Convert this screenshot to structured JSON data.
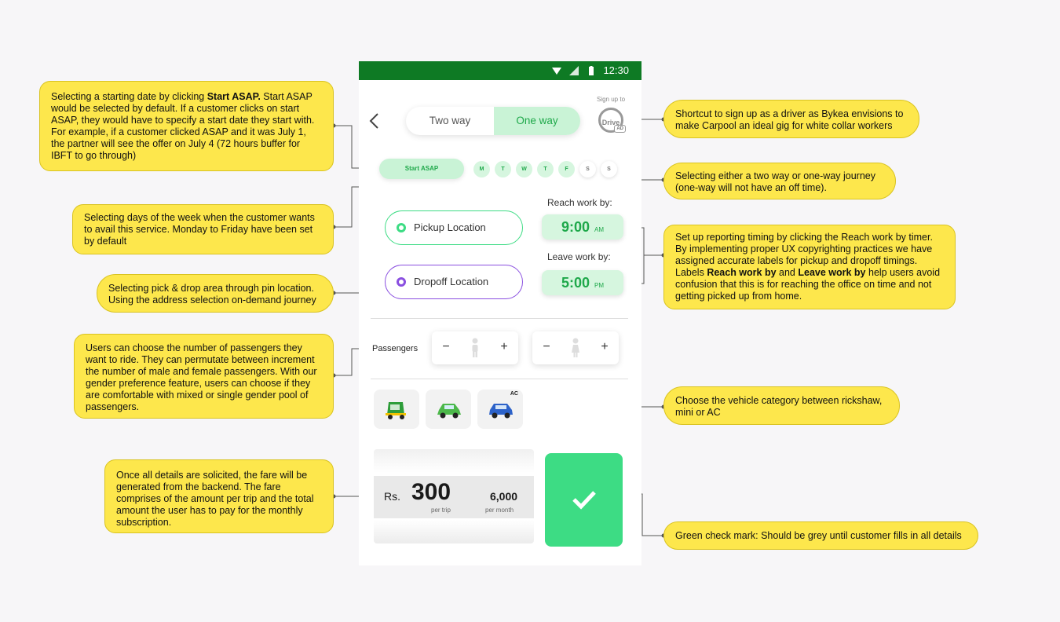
{
  "status_bar": {
    "time": "12:30"
  },
  "header": {
    "tab_two_way": "Two way",
    "tab_one_way": "One way",
    "signup_label": "Sign up to",
    "drive_badge": "Drive",
    "ad_tag": "AD"
  },
  "schedule": {
    "start_label": "Start ASAP",
    "days": [
      "M",
      "T",
      "W",
      "T",
      "F",
      "S",
      "S"
    ],
    "days_selected": [
      true,
      true,
      true,
      true,
      true,
      false,
      false
    ]
  },
  "locations": {
    "pickup": "Pickup Location",
    "dropoff": "Dropoff Location"
  },
  "timing": {
    "reach_label": "Reach work by:",
    "reach_time": "9:00",
    "reach_ampm": "AM",
    "leave_label": "Leave work by:",
    "leave_time": "5:00",
    "leave_ampm": "PM"
  },
  "passengers": {
    "label": "Passengers",
    "minus": "−",
    "plus": "+"
  },
  "vehicles": {
    "ac_tag": "AC",
    "items": [
      "rickshaw",
      "mini",
      "ac-car"
    ]
  },
  "fare": {
    "currency": "Rs.",
    "per_trip_amount": "300",
    "per_trip_label": "per trip",
    "per_month_amount": "6,000",
    "per_month_label": "per month"
  },
  "colors": {
    "status_bar": "#0e7a24",
    "accent_green": "#3ddc84",
    "accent_purple": "#8a4fe0",
    "callout_yellow": "#fde74c"
  },
  "notes": {
    "asap_pre": "Selecting a starting date by clicking ",
    "asap_bold": "Start ASAP.",
    "asap_post": " Start ASAP would be selected by default. If a customer clicks on start ASAP, they would have to specify a start date they start with. For example, if a customer clicked ASAP and it was July 1, the partner will see the offer on July 4 (72 hours buffer for IBFT to go through)",
    "days": "Selecting days of the week when the customer wants to avail this service. Monday to Friday have been set by default",
    "pin": "Selecting pick & drop area through pin location. Using the address selection on-demand journey",
    "passengers": "Users can choose the number of passengers they want to ride. They can permutate between increment the number of male and female passengers. With our gender preference feature, users can choose if they are comfortable with mixed or single gender pool of passengers.",
    "fare": "Once all details are solicited, the fare will be generated from the backend. The fare comprises of the amount per trip and the total amount the user has to pay for the monthly subscription.",
    "driver": "Shortcut to sign up as a driver as Bykea envisions to make Carpool an ideal gig for white collar workers",
    "journey": "Selecting either a two way or one-way journey (one-way will not have an off time).",
    "timer_pre": "Set up reporting timing by clicking the Reach work by timer. By implementing proper UX copyrighting practices we have assigned accurate labels for pickup and dropoff timings. Labels ",
    "timer_bold1": "Reach work by",
    "timer_mid": " and ",
    "timer_bold2": "Leave work by",
    "timer_post": " help users avoid confusion that this is for reaching the office on time and not getting picked up from home.",
    "vehicle": "Choose the vehicle category between rickshaw, mini or AC",
    "check": "Green check mark: Should be grey until customer fills in all details"
  }
}
